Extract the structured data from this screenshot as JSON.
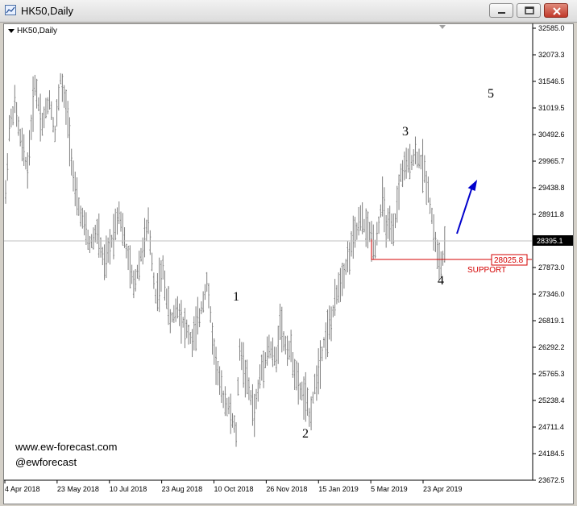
{
  "window": {
    "title": "HK50,Daily",
    "buttons": [
      "minimize",
      "restore",
      "close"
    ]
  },
  "chart_header": {
    "label": "HK50,Daily"
  },
  "watermark": {
    "site": "www.ew-forecast.com",
    "handle": "@ewforecast"
  },
  "colors": {
    "bar": "#7f7f7f",
    "support": "#d40000",
    "arrow": "#0000cc",
    "price_line": "#c0c0c0"
  },
  "annotations": {
    "wave_labels": [
      "1",
      "2",
      "3",
      "4",
      "5"
    ],
    "support_value": "28025.8",
    "support_label": "SUPPORT",
    "current_price": "28395.1"
  },
  "chart_data": {
    "type": "ohlc",
    "title": "HK50,Daily",
    "y_ticks": [
      "32585.0",
      "32073.3",
      "31546.5",
      "31019.5",
      "30492.6",
      "29965.7",
      "29438.8",
      "28911.8",
      "28395.1",
      "27873.0",
      "27346.0",
      "26819.1",
      "26292.2",
      "25765.3",
      "25238.4",
      "24711.4",
      "24184.5",
      "23672.5"
    ],
    "x_ticks": [
      "4 Apr 2018",
      "23 May 2018",
      "10 Jul 2018",
      "23 Aug 2018",
      "10 Oct 2018",
      "26 Nov 2018",
      "15 Jan 2019",
      "5 Mar 2019",
      "23 Apr 2019"
    ],
    "ylim": [
      23672.5,
      32585.0
    ],
    "path_points": [
      [
        0,
        29300
      ],
      [
        2,
        30600
      ],
      [
        5,
        31100
      ],
      [
        8,
        30400
      ],
      [
        12,
        29800
      ],
      [
        16,
        31500
      ],
      [
        20,
        30700
      ],
      [
        24,
        31200
      ],
      [
        27,
        30500
      ],
      [
        30,
        31600
      ],
      [
        34,
        30800
      ],
      [
        38,
        29300
      ],
      [
        42,
        28800
      ],
      [
        46,
        28300
      ],
      [
        50,
        28600
      ],
      [
        54,
        27900
      ],
      [
        58,
        28400
      ],
      [
        62,
        29000
      ],
      [
        66,
        28200
      ],
      [
        70,
        27500
      ],
      [
        74,
        28100
      ],
      [
        78,
        28700
      ],
      [
        82,
        27300
      ],
      [
        86,
        27800
      ],
      [
        90,
        26800
      ],
      [
        94,
        27100
      ],
      [
        98,
        26700
      ],
      [
        102,
        26400
      ],
      [
        106,
        26900
      ],
      [
        110,
        27600
      ],
      [
        114,
        26200
      ],
      [
        118,
        25400
      ],
      [
        122,
        25100
      ],
      [
        126,
        24600
      ],
      [
        128,
        26300
      ],
      [
        132,
        25600
      ],
      [
        136,
        25000
      ],
      [
        140,
        25900
      ],
      [
        144,
        26300
      ],
      [
        148,
        26000
      ],
      [
        150,
        26900
      ],
      [
        152,
        26400
      ],
      [
        156,
        26200
      ],
      [
        160,
        25500
      ],
      [
        164,
        25300
      ],
      [
        166,
        24900
      ],
      [
        170,
        25700
      ],
      [
        174,
        26400
      ],
      [
        178,
        26800
      ],
      [
        182,
        27500
      ],
      [
        186,
        27900
      ],
      [
        190,
        28400
      ],
      [
        194,
        28800
      ],
      [
        198,
        28600
      ],
      [
        202,
        28300
      ],
      [
        206,
        29200
      ],
      [
        208,
        28700
      ],
      [
        212,
        28500
      ],
      [
        216,
        29700
      ],
      [
        220,
        29900
      ],
      [
        224,
        30100
      ],
      [
        228,
        29900
      ],
      [
        231,
        29400
      ],
      [
        234,
        28600
      ],
      [
        236,
        28100
      ],
      [
        238,
        27900
      ],
      [
        240,
        28200
      ]
    ]
  }
}
